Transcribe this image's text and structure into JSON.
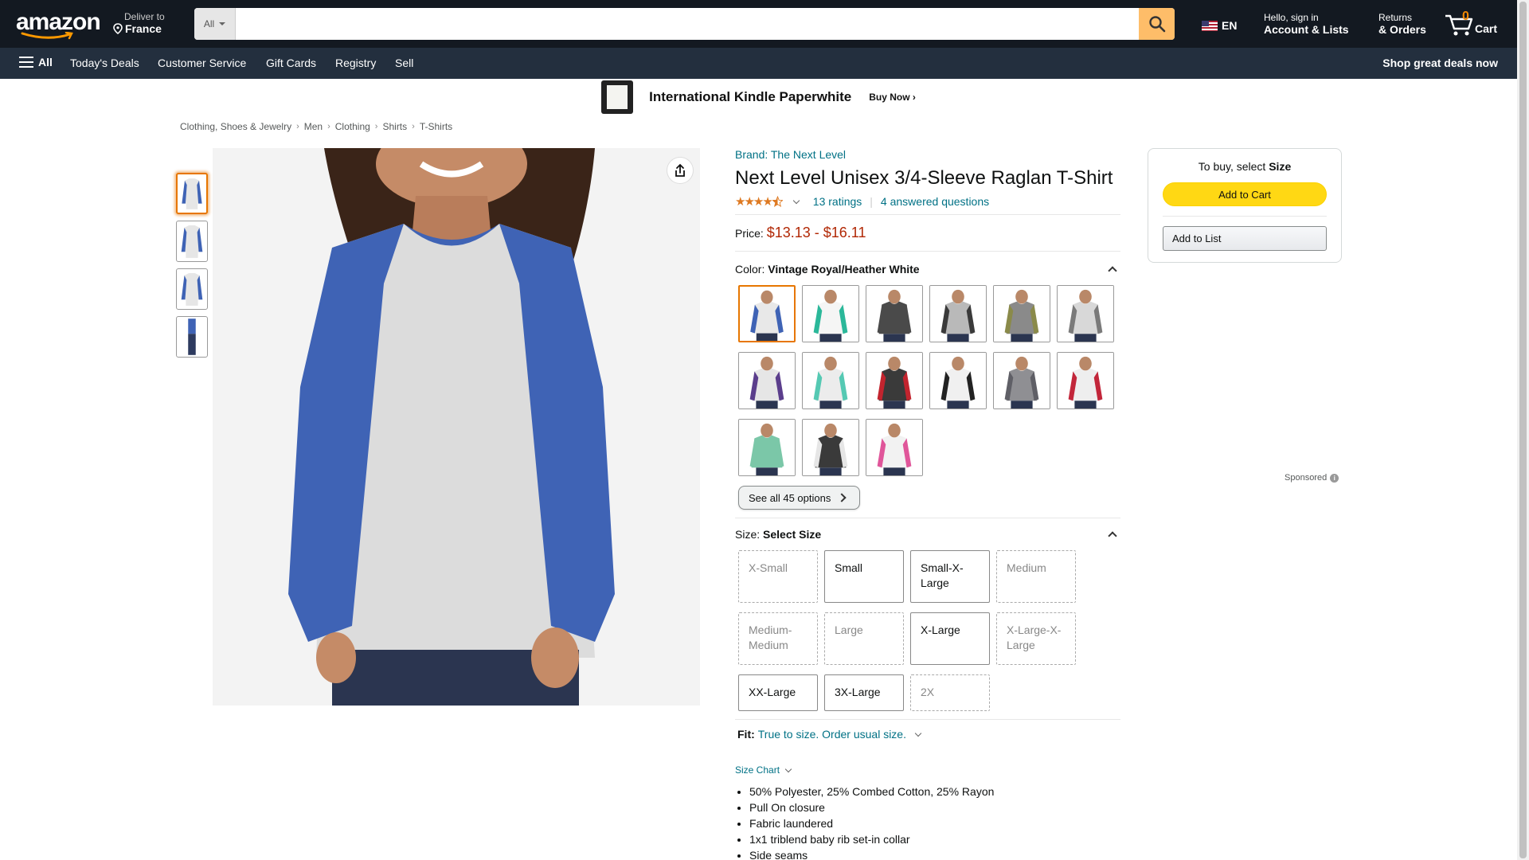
{
  "nav": {
    "logo": "amazon",
    "deliver_line1": "Deliver to",
    "deliver_line2": "France",
    "search_category": "All",
    "search_placeholder": "",
    "language": "EN",
    "account_line1": "Hello, sign in",
    "account_line2": "Account & Lists",
    "returns_line1": "Returns",
    "returns_line2": "& Orders",
    "cart_count": "0",
    "cart_label": "Cart"
  },
  "subnav": {
    "all": "All",
    "items": [
      "Today's Deals",
      "Customer Service",
      "Gift Cards",
      "Registry",
      "Sell"
    ],
    "promo": "Shop great deals now"
  },
  "banner": {
    "title": "International Kindle Paperwhite",
    "cta": "Buy Now ›"
  },
  "breadcrumb": [
    "Clothing, Shoes & Jewelry",
    "Men",
    "Clothing",
    "Shirts",
    "T-Shirts"
  ],
  "product": {
    "brand": "Brand: The Next Level",
    "title": "Next Level Unisex 3/4-Sleeve Raglan T-Shirt",
    "rating_stars": 4.5,
    "ratings": "13 ratings",
    "questions": "4 answered questions",
    "price_label": "Price:",
    "price": "$13.13 - $16.11",
    "color_label": "Color:",
    "color_value": "Vintage Royal/Heather White",
    "swatch_colors": [
      {
        "body": "#e8e8e8",
        "sleeve": "#3f63b5"
      },
      {
        "body": "#f5f5f5",
        "sleeve": "#2bb89a"
      },
      {
        "body": "#4a4a4a",
        "sleeve": "#4a4a4a"
      },
      {
        "body": "#b9b9b9",
        "sleeve": "#3a3a3a"
      },
      {
        "body": "#8a8a8a",
        "sleeve": "#8a8a4a"
      },
      {
        "body": "#d8d8d8",
        "sleeve": "#7a7a7a"
      },
      {
        "body": "#e6e6e6",
        "sleeve": "#5b3e8c"
      },
      {
        "body": "#ececec",
        "sleeve": "#55c9b3"
      },
      {
        "body": "#3a3a3a",
        "sleeve": "#c2242e"
      },
      {
        "body": "#f0f0f0",
        "sleeve": "#222222"
      },
      {
        "body": "#8f8f93",
        "sleeve": "#5f5f66"
      },
      {
        "body": "#eeeeee",
        "sleeve": "#c2263a"
      },
      {
        "body": "#7bc7a8",
        "sleeve": "#7bc7a8"
      },
      {
        "body": "#3a3a3a",
        "sleeve": "#e6e6e6"
      },
      {
        "body": "#f2f2f2",
        "sleeve": "#e0569a"
      }
    ],
    "see_all": "See all 45 options",
    "size_label": "Size:",
    "size_value": "Select Size",
    "sizes": [
      {
        "label": "X-Small",
        "available": false
      },
      {
        "label": "Small",
        "available": true
      },
      {
        "label": "Small-X-Large",
        "available": true
      },
      {
        "label": "Medium",
        "available": false
      },
      {
        "label": "Medium-Medium",
        "available": false
      },
      {
        "label": "Large",
        "available": false
      },
      {
        "label": "X-Large",
        "available": true
      },
      {
        "label": "X-Large-X-Large",
        "available": false
      },
      {
        "label": "XX-Large",
        "available": true
      },
      {
        "label": "3X-Large",
        "available": true
      },
      {
        "label": "2X",
        "available": false
      }
    ],
    "fit_label": "Fit:",
    "fit_value": "True to size. Order usual size.",
    "size_chart": "Size Chart",
    "bullets": [
      "50% Polyester, 25% Combed Cotton, 25% Rayon",
      "Pull On closure",
      "Fabric laundered",
      "1x1 triblend baby rib set-in collar",
      "Side seams"
    ]
  },
  "buybox": {
    "prompt_prefix": "To buy, select ",
    "prompt_bold": "Size",
    "add_to_cart": "Add to Cart",
    "add_to_list": "Add to List"
  },
  "sponsored": "Sponsored",
  "colors": {
    "nav_bg": "#131921",
    "subnav_bg": "#232f3e",
    "search_btn": "#febd69",
    "link": "#007185",
    "price": "#b12704",
    "cart_btn": "#ffd814",
    "selected": "#e77600"
  }
}
